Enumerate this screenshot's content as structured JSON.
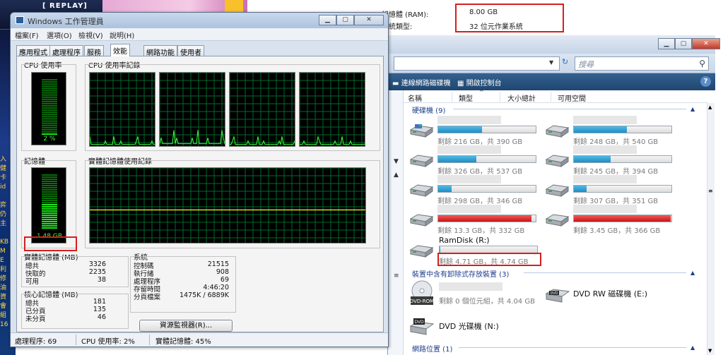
{
  "background": {
    "replay_label": "[ REPLAY]"
  },
  "sysinfo": {
    "ram_label": "記憶體 (RAM):",
    "ram_value": "8.00 GB",
    "systype_label": "系統類型:",
    "systype_value": "32 位元作業系統"
  },
  "explorer": {
    "search_placeholder": "搜尋",
    "toolbar": {
      "map_drive": "連線網路磁碟機",
      "control_panel": "開啟控制台"
    },
    "columns": {
      "name": "名稱",
      "type": "類型",
      "total": "大小總計",
      "free": "可用空間"
    },
    "groups": {
      "hdd": "硬碟機 (9)",
      "removable": "裝置中含有卸除式存放裝置 (3)",
      "network": "網路位置 (1)"
    },
    "drives": [
      {
        "info": "剩餘 216 GB，共 390 GB",
        "used": 0.45,
        "color": "blue"
      },
      {
        "info": "剩餘 248 GB，共 540 GB",
        "used": 0.54,
        "color": "blue"
      },
      {
        "info": "剩餘 326 GB，共 537 GB",
        "used": 0.39,
        "color": "blue"
      },
      {
        "info": "剩餘 245 GB，共 394 GB",
        "used": 0.38,
        "color": "blue"
      },
      {
        "info": "剩餘 298 GB，共 346 GB",
        "used": 0.14,
        "color": "blue"
      },
      {
        "info": "剩餘 307 GB，共 351 GB",
        "used": 0.13,
        "color": "blue"
      },
      {
        "info": "剩餘 13.3 GB，共 332 GB",
        "used": 0.96,
        "color": "red"
      },
      {
        "info": "剩餘 3.45 GB，共 366 GB",
        "used": 0.99,
        "color": "red"
      }
    ],
    "ramdisk": {
      "name": "RamDisk (R:)",
      "info": "剩餘 4.71 GB，共 4.74 GB",
      "used": 0.01
    },
    "dvdrom": {
      "icon_text": "DVD-ROM",
      "info": "剩餘 0 個位元組，共 4.04 GB"
    },
    "dvdrw": {
      "icon_text": "DVD",
      "name": "DVD RW 磁碟機 (E:)"
    },
    "dvd_n": {
      "icon_text": "DVD",
      "name": "DVD 光碟機 (N:)"
    }
  },
  "taskmgr": {
    "title": "Windows 工作管理員",
    "menu": [
      "檔案(F)",
      "選項(O)",
      "檢視(V)",
      "說明(H)"
    ],
    "tabs": [
      "應用程式",
      "處理程序",
      "服務",
      "效能",
      "網路功能",
      "使用者"
    ],
    "active_tab": 3,
    "cpu_usage_label": "CPU 使用率",
    "cpu_history_label": "CPU 使用率記錄",
    "cpu_percent": "2 %",
    "cpu_fraction": 0.02,
    "memory_label": "記憶體",
    "memory_history_label": "實體記憶體使用記錄",
    "memory_value": "1.48 GB",
    "memory_fraction": 0.45,
    "physical_memory": {
      "title": "實體記憶體 (MB)",
      "rows": [
        {
          "label": "總共",
          "value": "3326"
        },
        {
          "label": "快取的",
          "value": "2235"
        },
        {
          "label": "可用",
          "value": "38"
        }
      ]
    },
    "kernel_memory": {
      "title": "核心記憶體 (MB)",
      "rows": [
        {
          "label": "總共",
          "value": "181"
        },
        {
          "label": "已分頁",
          "value": "135"
        },
        {
          "label": "未分頁",
          "value": "46"
        }
      ]
    },
    "system": {
      "title": "系統",
      "rows": [
        {
          "label": "控制碼",
          "value": "21515"
        },
        {
          "label": "執行緒",
          "value": "908"
        },
        {
          "label": "處理程序",
          "value": "69"
        },
        {
          "label": "存留時間",
          "value": "4:46:20"
        },
        {
          "label": "分頁檔案",
          "value": "1475K / 6889K"
        }
      ]
    },
    "resource_monitor_button": "資源監視器(R)...",
    "status": {
      "processes": "處理程序: 69",
      "cpu": "CPU 使用率: 2%",
      "memory": "實體記憶體: 45%"
    }
  }
}
